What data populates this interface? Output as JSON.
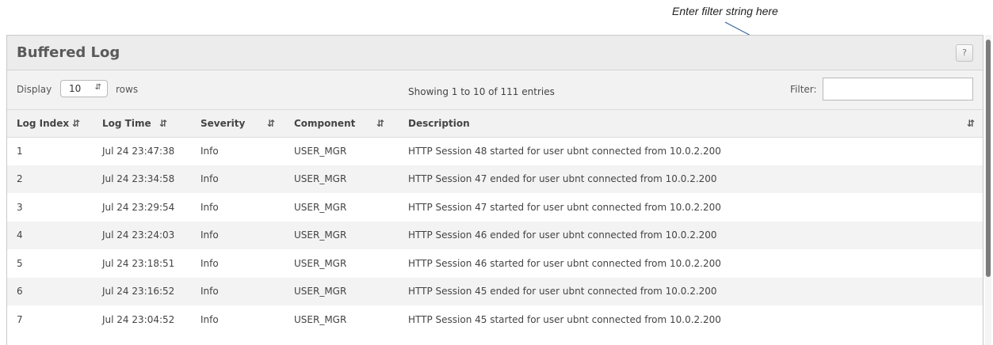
{
  "annotation": {
    "text": "Enter filter string here"
  },
  "panel": {
    "title": "Buffered Log",
    "help_label": "?"
  },
  "toolbar": {
    "display_label": "Display",
    "rows_value": "10",
    "rows_label": "rows",
    "showing_text": "Showing 1 to 10 of 111 entries",
    "filter_label": "Filter:",
    "filter_value": ""
  },
  "table": {
    "columns": [
      {
        "label": "Log Index"
      },
      {
        "label": "Log Time"
      },
      {
        "label": "Severity"
      },
      {
        "label": "Component"
      },
      {
        "label": "Description"
      }
    ],
    "rows": [
      {
        "index": "1",
        "time": "Jul 24 23:47:38",
        "severity": "Info",
        "component": "USER_MGR",
        "description": "HTTP Session 48 started for user ubnt connected from 10.0.2.200"
      },
      {
        "index": "2",
        "time": "Jul 24 23:34:58",
        "severity": "Info",
        "component": "USER_MGR",
        "description": "HTTP Session 47 ended for user ubnt connected from 10.0.2.200"
      },
      {
        "index": "3",
        "time": "Jul 24 23:29:54",
        "severity": "Info",
        "component": "USER_MGR",
        "description": "HTTP Session 47 started for user ubnt connected from 10.0.2.200"
      },
      {
        "index": "4",
        "time": "Jul 24 23:24:03",
        "severity": "Info",
        "component": "USER_MGR",
        "description": "HTTP Session 46 ended for user ubnt connected from 10.0.2.200"
      },
      {
        "index": "5",
        "time": "Jul 24 23:18:51",
        "severity": "Info",
        "component": "USER_MGR",
        "description": "HTTP Session 46 started for user ubnt connected from 10.0.2.200"
      },
      {
        "index": "6",
        "time": "Jul 24 23:16:52",
        "severity": "Info",
        "component": "USER_MGR",
        "description": "HTTP Session 45 ended for user ubnt connected from 10.0.2.200"
      },
      {
        "index": "7",
        "time": "Jul 24 23:04:52",
        "severity": "Info",
        "component": "USER_MGR",
        "description": "HTTP Session 45 started for user ubnt connected from 10.0.2.200"
      }
    ]
  },
  "icons": {
    "sort": "sort-icon",
    "select_caret": "select-caret-icon",
    "help": "help-icon"
  },
  "colors": {
    "header_bg": "#ececec",
    "toolbar_bg": "#f2f2f2",
    "stripe": "#f3f3f3",
    "callout_line": "#2a5f9a"
  }
}
